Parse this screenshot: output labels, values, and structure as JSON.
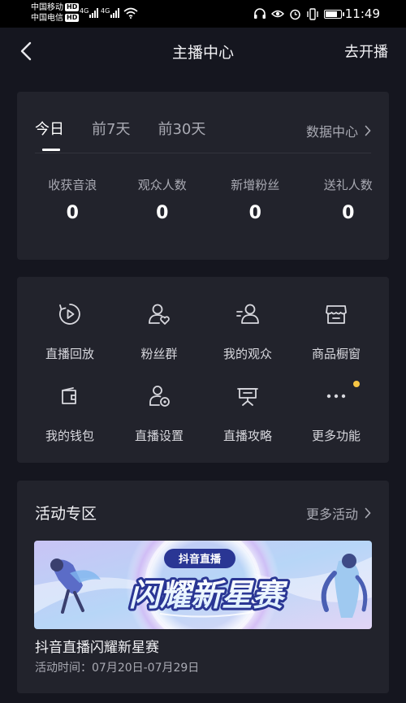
{
  "status_bar": {
    "carrier_1": "中国移动",
    "carrier_2": "中国电信",
    "hd_badge": "HD",
    "network_1": "4G",
    "network_2": "4G",
    "time": "11:49"
  },
  "nav": {
    "title": "主播中心",
    "action_label": "去开播"
  },
  "stats": {
    "tabs": [
      {
        "label": "今日",
        "active": true
      },
      {
        "label": "前7天",
        "active": false
      },
      {
        "label": "前30天",
        "active": false
      }
    ],
    "data_center_link": "数据中心",
    "items": [
      {
        "label": "收获音浪",
        "value": "0"
      },
      {
        "label": "观众人数",
        "value": "0"
      },
      {
        "label": "新增粉丝",
        "value": "0"
      },
      {
        "label": "送礼人数",
        "value": "0"
      }
    ]
  },
  "features": [
    {
      "label": "直播回放",
      "icon": "replay-icon"
    },
    {
      "label": "粉丝群",
      "icon": "fan-group-icon"
    },
    {
      "label": "我的观众",
      "icon": "audience-icon"
    },
    {
      "label": "商品橱窗",
      "icon": "shop-window-icon"
    },
    {
      "label": "我的钱包",
      "icon": "wallet-icon"
    },
    {
      "label": "直播设置",
      "icon": "live-settings-icon"
    },
    {
      "label": "直播攻略",
      "icon": "guide-icon"
    },
    {
      "label": "更多功能",
      "icon": "more-icon",
      "badge_dot_color": "#f6c544"
    }
  ],
  "activity": {
    "title": "活动专区",
    "more_link": "更多活动",
    "banner": {
      "brand_text": "抖音直播",
      "headline_text": "闪耀新星赛"
    },
    "event_name": "抖音直播闪耀新星赛",
    "event_time": "活动时间：07月20日-07月29日"
  },
  "colors": {
    "background": "#15161f",
    "card": "#22232c",
    "muted_text": "#a9aab3",
    "badge_dot": "#f6c544"
  }
}
